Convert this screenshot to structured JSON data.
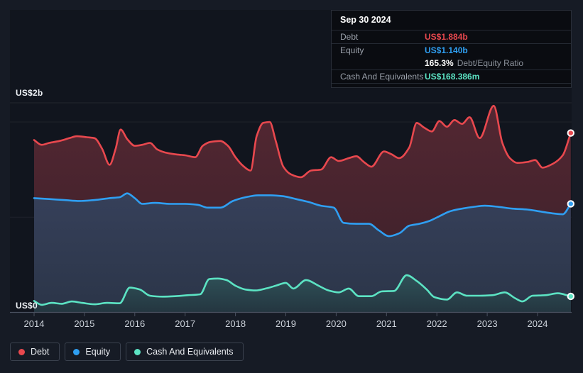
{
  "tooltip": {
    "date": "Sep 30 2024",
    "debt_label": "Debt",
    "debt_value": "US$1.884b",
    "equity_label": "Equity",
    "equity_value": "US$1.140b",
    "ratio_value": "165.3%",
    "ratio_label": "Debt/Equity Ratio",
    "cash_label": "Cash And Equivalents",
    "cash_value": "US$168.386m"
  },
  "chart_data": {
    "type": "area",
    "unit": "US$ billions",
    "grid": "horizontal",
    "legend_position": "bottom-left",
    "xlim": [
      2014,
      2024.75
    ],
    "ylim": [
      0,
      2.2
    ],
    "x_ticks": [
      "2014",
      "2015",
      "2016",
      "2017",
      "2018",
      "2019",
      "2020",
      "2021",
      "2022",
      "2023",
      "2024"
    ],
    "y_axis": {
      "top_label": "US$2b",
      "bottom_label": "US$0",
      "max_value_b": 2,
      "min_value_b": 0
    },
    "series": [
      {
        "name": "Debt",
        "color": "#e8484e",
        "fill_top": "#532732",
        "fill_bottom": "#3a2029",
        "x": [
          2014.0,
          2014.15,
          2014.3,
          2014.5,
          2014.7,
          2014.85,
          2015.05,
          2015.2,
          2015.35,
          2015.5,
          2015.62,
          2015.72,
          2015.85,
          2016.0,
          2016.15,
          2016.3,
          2016.45,
          2016.6,
          2016.8,
          2017.0,
          2017.2,
          2017.35,
          2017.5,
          2017.7,
          2017.85,
          2018.0,
          2018.15,
          2018.3,
          2018.42,
          2018.55,
          2018.68,
          2018.8,
          2018.95,
          2019.1,
          2019.3,
          2019.5,
          2019.7,
          2019.9,
          2020.05,
          2020.25,
          2020.4,
          2020.55,
          2020.7,
          2020.95,
          2021.1,
          2021.25,
          2021.45,
          2021.6,
          2021.75,
          2021.9,
          2022.05,
          2022.2,
          2022.35,
          2022.5,
          2022.65,
          2022.85,
          2023.13,
          2023.3,
          2023.45,
          2023.6,
          2023.8,
          2023.95,
          2024.1,
          2024.3,
          2024.5,
          2024.66
        ],
        "values": [
          1.81,
          1.76,
          1.78,
          1.8,
          1.83,
          1.85,
          1.84,
          1.83,
          1.72,
          1.55,
          1.72,
          1.92,
          1.82,
          1.75,
          1.76,
          1.78,
          1.71,
          1.68,
          1.66,
          1.65,
          1.63,
          1.75,
          1.79,
          1.8,
          1.75,
          1.63,
          1.54,
          1.49,
          1.85,
          1.99,
          2.0,
          1.8,
          1.53,
          1.45,
          1.42,
          1.49,
          1.5,
          1.63,
          1.59,
          1.62,
          1.64,
          1.58,
          1.53,
          1.69,
          1.66,
          1.62,
          1.73,
          1.99,
          1.94,
          1.9,
          2.01,
          1.95,
          2.02,
          1.98,
          2.05,
          1.83,
          2.17,
          1.78,
          1.62,
          1.57,
          1.58,
          1.6,
          1.52,
          1.56,
          1.65,
          1.884
        ]
      },
      {
        "name": "Equity",
        "color": "#2f9ff2",
        "fill_top": "#36405a",
        "fill_bottom": "#2b3548",
        "x": [
          2014.0,
          2014.3,
          2014.6,
          2014.9,
          2015.2,
          2015.5,
          2015.7,
          2015.85,
          2016.0,
          2016.15,
          2016.4,
          2016.7,
          2017.0,
          2017.25,
          2017.45,
          2017.7,
          2017.95,
          2018.2,
          2018.45,
          2018.7,
          2018.95,
          2019.2,
          2019.45,
          2019.7,
          2019.95,
          2020.15,
          2020.4,
          2020.65,
          2020.85,
          2021.05,
          2021.25,
          2021.45,
          2021.65,
          2021.85,
          2022.05,
          2022.25,
          2022.5,
          2022.75,
          2022.95,
          2023.2,
          2023.5,
          2023.8,
          2024.05,
          2024.3,
          2024.5,
          2024.66
        ],
        "values": [
          1.2,
          1.19,
          1.18,
          1.17,
          1.18,
          1.2,
          1.21,
          1.25,
          1.2,
          1.14,
          1.15,
          1.14,
          1.14,
          1.13,
          1.1,
          1.1,
          1.17,
          1.21,
          1.23,
          1.23,
          1.22,
          1.19,
          1.16,
          1.12,
          1.1,
          0.94,
          0.93,
          0.93,
          0.86,
          0.8,
          0.83,
          0.91,
          0.93,
          0.96,
          1.01,
          1.06,
          1.09,
          1.11,
          1.12,
          1.11,
          1.09,
          1.08,
          1.06,
          1.04,
          1.03,
          1.14
        ]
      },
      {
        "name": "Cash And Equivalents",
        "color": "#5ce3c3",
        "fill_top": "#2f5158",
        "fill_bottom": "#243640",
        "x": [
          2014.0,
          2014.15,
          2014.35,
          2014.55,
          2014.75,
          2014.95,
          2015.2,
          2015.45,
          2015.7,
          2015.9,
          2016.1,
          2016.3,
          2016.55,
          2016.8,
          2017.05,
          2017.3,
          2017.48,
          2017.65,
          2017.82,
          2018.0,
          2018.2,
          2018.4,
          2018.6,
          2018.8,
          2019.0,
          2019.15,
          2019.4,
          2019.65,
          2019.85,
          2020.05,
          2020.25,
          2020.45,
          2020.7,
          2020.9,
          2021.15,
          2021.4,
          2021.6,
          2021.8,
          2021.95,
          2022.2,
          2022.4,
          2022.6,
          2022.85,
          2023.1,
          2023.35,
          2023.55,
          2023.7,
          2023.9,
          2024.15,
          2024.4,
          2024.66
        ],
        "values": [
          0.12,
          0.08,
          0.1,
          0.09,
          0.115,
          0.1,
          0.085,
          0.1,
          0.095,
          0.26,
          0.24,
          0.175,
          0.165,
          0.17,
          0.18,
          0.19,
          0.35,
          0.355,
          0.34,
          0.28,
          0.24,
          0.23,
          0.25,
          0.28,
          0.31,
          0.25,
          0.34,
          0.28,
          0.23,
          0.21,
          0.25,
          0.17,
          0.17,
          0.22,
          0.225,
          0.39,
          0.33,
          0.24,
          0.16,
          0.135,
          0.21,
          0.175,
          0.175,
          0.18,
          0.21,
          0.15,
          0.115,
          0.175,
          0.18,
          0.2,
          0.168
        ]
      }
    ]
  },
  "colors": {
    "page_bg": "#161b25",
    "plot_bg": "#11151e",
    "axis_line": "#4a5160",
    "grid_line": "rgba(255,255,255,0.06)"
  }
}
